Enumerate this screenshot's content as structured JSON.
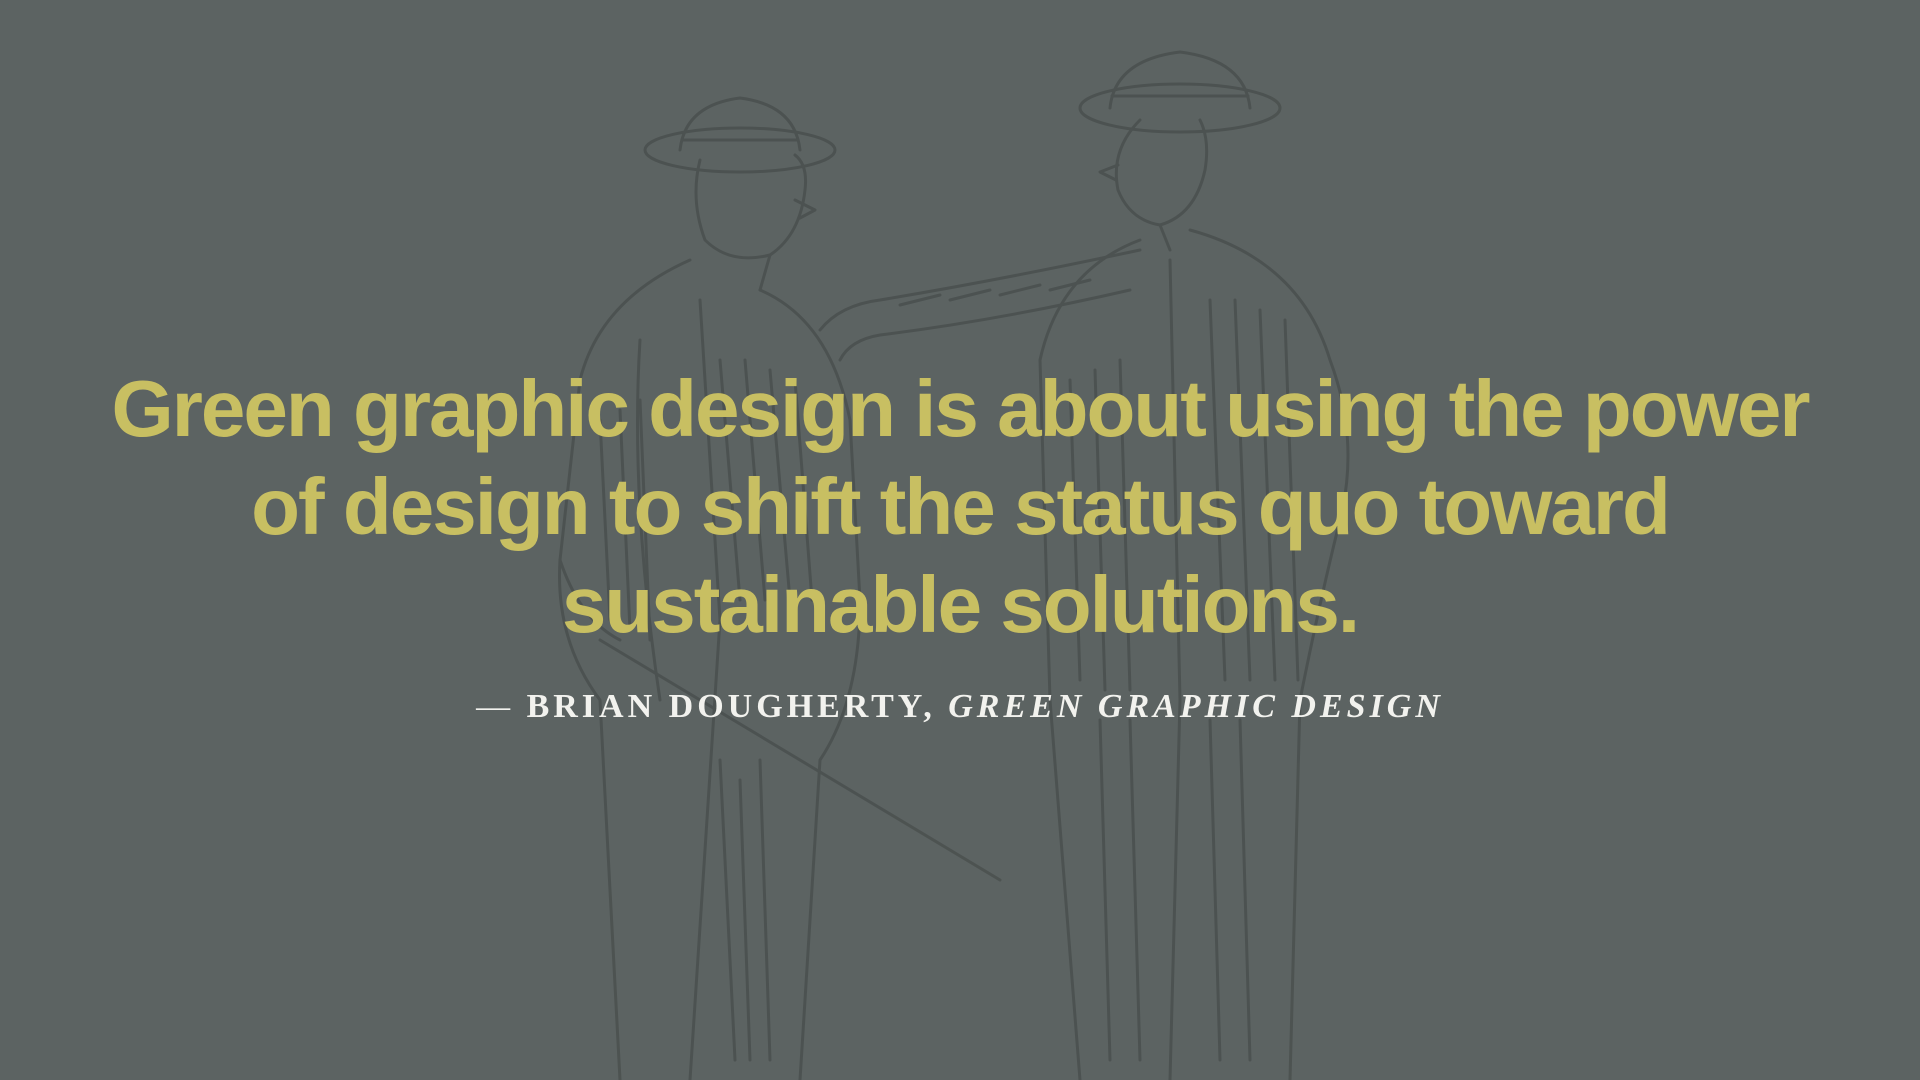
{
  "quote": {
    "text": "Green graphic design is about using the power of design to shift the status quo toward sustainable solutions."
  },
  "attribution": {
    "dash": "—",
    "author": "BRIAN DOUGHERTY,",
    "source": "GREEN GRAPHIC DESIGN"
  },
  "colors": {
    "background": "#5c6362",
    "quote_text": "#c8bf62",
    "attribution_text": "#f2f2ee",
    "illustration_ink": "#4a504f"
  },
  "illustration": {
    "icon": "two-gentlemen-engraving-icon"
  }
}
